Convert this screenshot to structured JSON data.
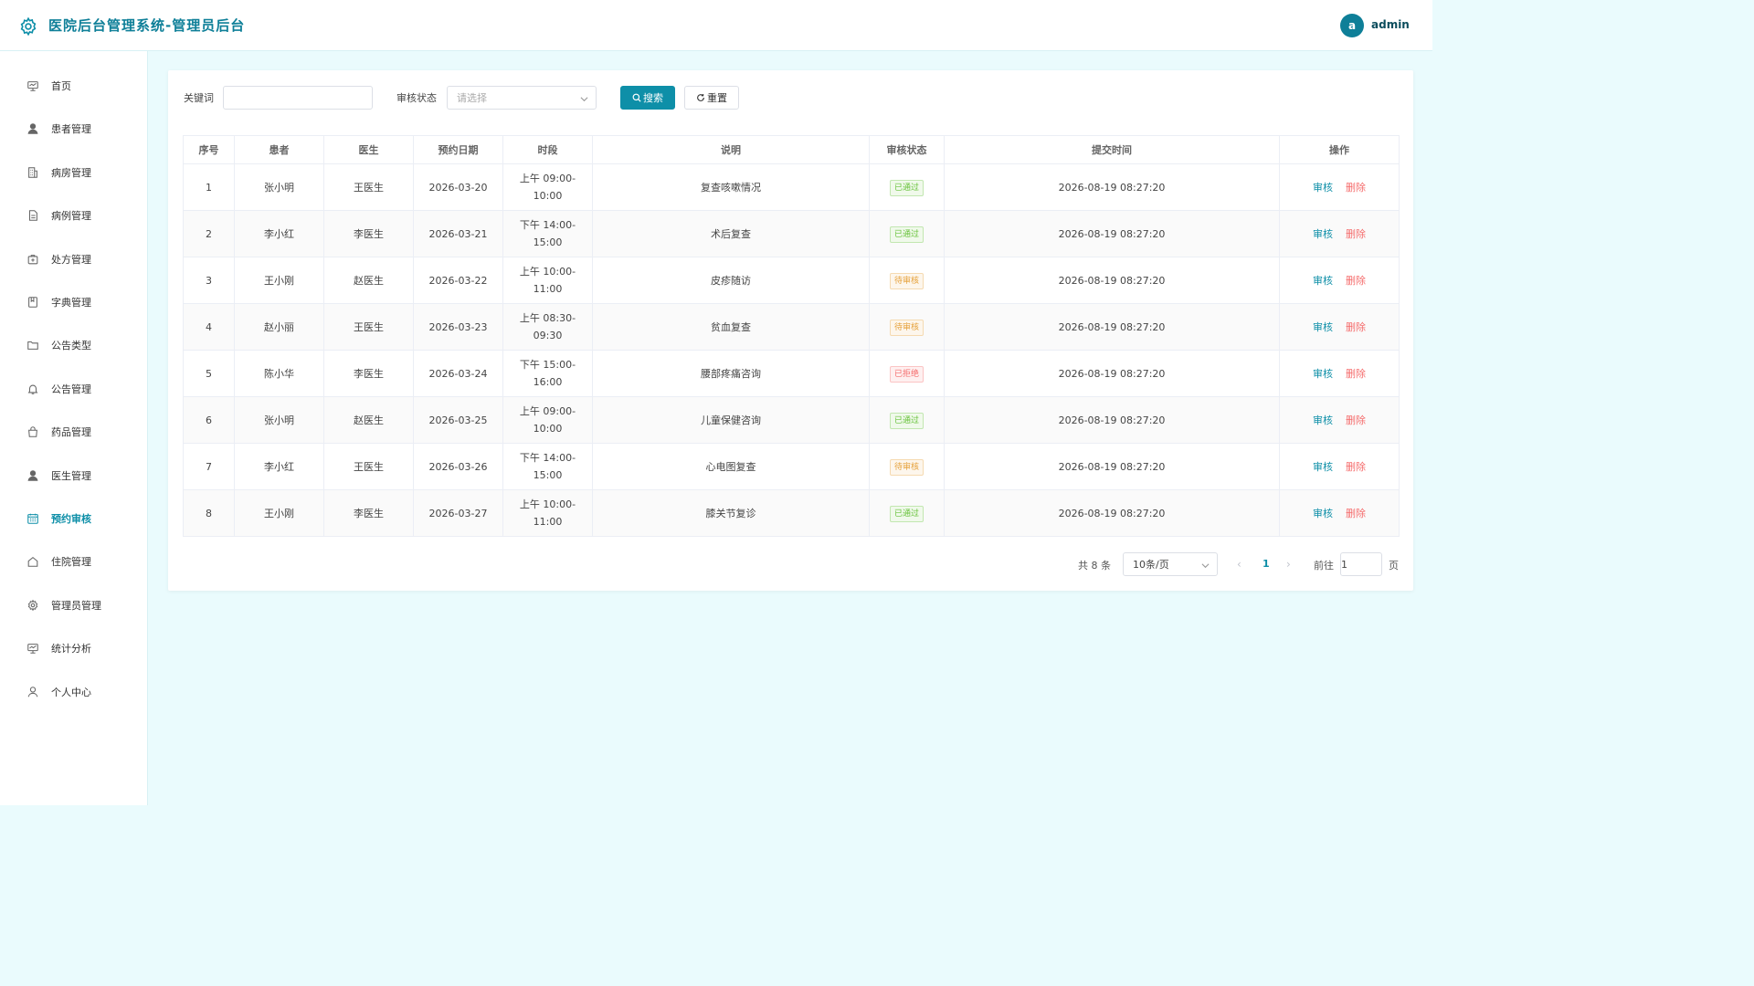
{
  "app": {
    "title": "医院后台管理系统-管理员后台",
    "user_initial": "a",
    "username": "admin"
  },
  "sidebar": {
    "items": [
      {
        "label": "首页",
        "icon": "dashboard-icon"
      },
      {
        "label": "患者管理",
        "icon": "user-icon"
      },
      {
        "label": "病房管理",
        "icon": "building-icon"
      },
      {
        "label": "病例管理",
        "icon": "document-icon"
      },
      {
        "label": "处方管理",
        "icon": "medical-kit-icon"
      },
      {
        "label": "字典管理",
        "icon": "notebook-icon"
      },
      {
        "label": "公告类型",
        "icon": "folder-icon"
      },
      {
        "label": "公告管理",
        "icon": "bell-icon"
      },
      {
        "label": "药品管理",
        "icon": "bag-icon"
      },
      {
        "label": "医生管理",
        "icon": "doctor-icon"
      },
      {
        "label": "预约审核",
        "icon": "calendar-icon"
      },
      {
        "label": "住院管理",
        "icon": "house-icon"
      },
      {
        "label": "管理员管理",
        "icon": "gear-icon"
      },
      {
        "label": "统计分析",
        "icon": "chart-board-icon"
      },
      {
        "label": "个人中心",
        "icon": "person-outline-icon"
      }
    ],
    "active_index": 10
  },
  "filters": {
    "keyword_label": "关键词",
    "keyword_value": "",
    "status_label": "审核状态",
    "status_placeholder": "请选择",
    "search_label": "搜索",
    "reset_label": "重置"
  },
  "table": {
    "columns": [
      "序号",
      "患者",
      "医生",
      "预约日期",
      "时段",
      "说明",
      "审核状态",
      "提交时间",
      "操作"
    ],
    "action_audit": "审核",
    "action_delete": "删除",
    "rows": [
      {
        "no": "1",
        "patient": "张小明",
        "doctor": "王医生",
        "date": "2026-03-20",
        "slot": "上午 09:00-10:00",
        "desc": "复查咳嗽情况",
        "status": "已通过",
        "status_type": "ok",
        "submitted": "2026-08-19 08:27:20"
      },
      {
        "no": "2",
        "patient": "李小红",
        "doctor": "李医生",
        "date": "2026-03-21",
        "slot": "下午 14:00-15:00",
        "desc": "术后复查",
        "status": "已通过",
        "status_type": "ok",
        "submitted": "2026-08-19 08:27:20"
      },
      {
        "no": "3",
        "patient": "王小刚",
        "doctor": "赵医生",
        "date": "2026-03-22",
        "slot": "上午 10:00-11:00",
        "desc": "皮疹随访",
        "status": "待审核",
        "status_type": "wait",
        "submitted": "2026-08-19 08:27:20"
      },
      {
        "no": "4",
        "patient": "赵小丽",
        "doctor": "王医生",
        "date": "2026-03-23",
        "slot": "上午 08:30-09:30",
        "desc": "贫血复查",
        "status": "待审核",
        "status_type": "wait",
        "submitted": "2026-08-19 08:27:20"
      },
      {
        "no": "5",
        "patient": "陈小华",
        "doctor": "李医生",
        "date": "2026-03-24",
        "slot": "下午 15:00-16:00",
        "desc": "腰部疼痛咨询",
        "status": "已拒绝",
        "status_type": "reject",
        "submitted": "2026-08-19 08:27:20"
      },
      {
        "no": "6",
        "patient": "张小明",
        "doctor": "赵医生",
        "date": "2026-03-25",
        "slot": "上午 09:00-10:00",
        "desc": "儿童保健咨询",
        "status": "已通过",
        "status_type": "ok",
        "submitted": "2026-08-19 08:27:20"
      },
      {
        "no": "7",
        "patient": "李小红",
        "doctor": "王医生",
        "date": "2026-03-26",
        "slot": "下午 14:00-15:00",
        "desc": "心电图复查",
        "status": "待审核",
        "status_type": "wait",
        "submitted": "2026-08-19 08:27:20"
      },
      {
        "no": "8",
        "patient": "王小刚",
        "doctor": "李医生",
        "date": "2026-03-27",
        "slot": "上午 10:00-11:00",
        "desc": "膝关节复诊",
        "status": "已通过",
        "status_type": "ok",
        "submitted": "2026-08-19 08:27:20"
      }
    ]
  },
  "pagination": {
    "total_text": "共 8 条",
    "page_size": "10条/页",
    "current_page": "1",
    "goto_label": "前往",
    "goto_value": "1",
    "page_unit": "页"
  },
  "colors": {
    "accent": "#0e8fa8",
    "ok": "#67c23a",
    "wait": "#e6a23c",
    "reject": "#f56c6c"
  }
}
